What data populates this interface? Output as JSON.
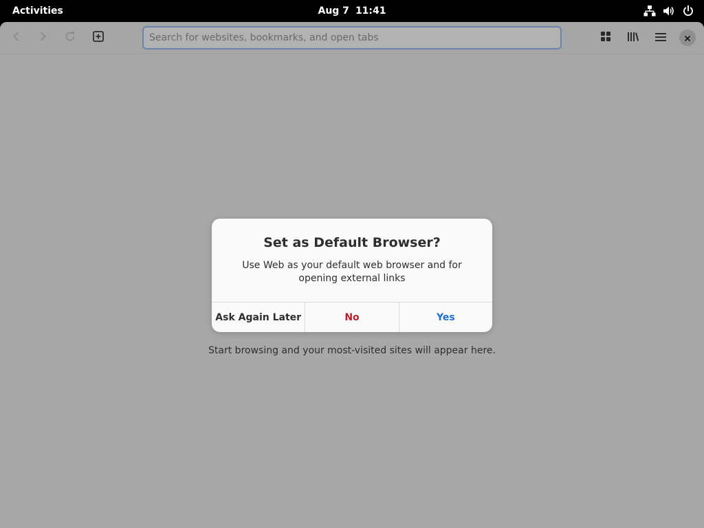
{
  "topbar": {
    "activities": "Activities",
    "date": "Aug 7",
    "time": "11:41",
    "icons": [
      "network-wired-icon",
      "volume-icon",
      "power-icon"
    ]
  },
  "headerbar": {
    "icons": [
      "back-arrow-icon",
      "forward-arrow-icon",
      "reload-icon",
      "new-tab-icon",
      "tabs-overview-icon",
      "library-icon",
      "hamburger-menu-icon",
      "close-icon"
    ],
    "search_placeholder": "Search for websites, bookmarks, and open tabs",
    "search_value": ""
  },
  "content": {
    "empty_message": "Start browsing and your most-visited sites will appear here."
  },
  "dialog": {
    "title": "Set as Default Browser?",
    "body": "Use Web as your default web browser and for opening external links",
    "actions": {
      "later": "Ask Again Later",
      "no": "No",
      "yes": "Yes"
    }
  },
  "colors": {
    "topbar_bg": "#000000",
    "window_bg": "#a8a8a8",
    "destructive": "#c01c28",
    "accent": "#1c71d8",
    "url_focus_border": "#6a83ad"
  }
}
